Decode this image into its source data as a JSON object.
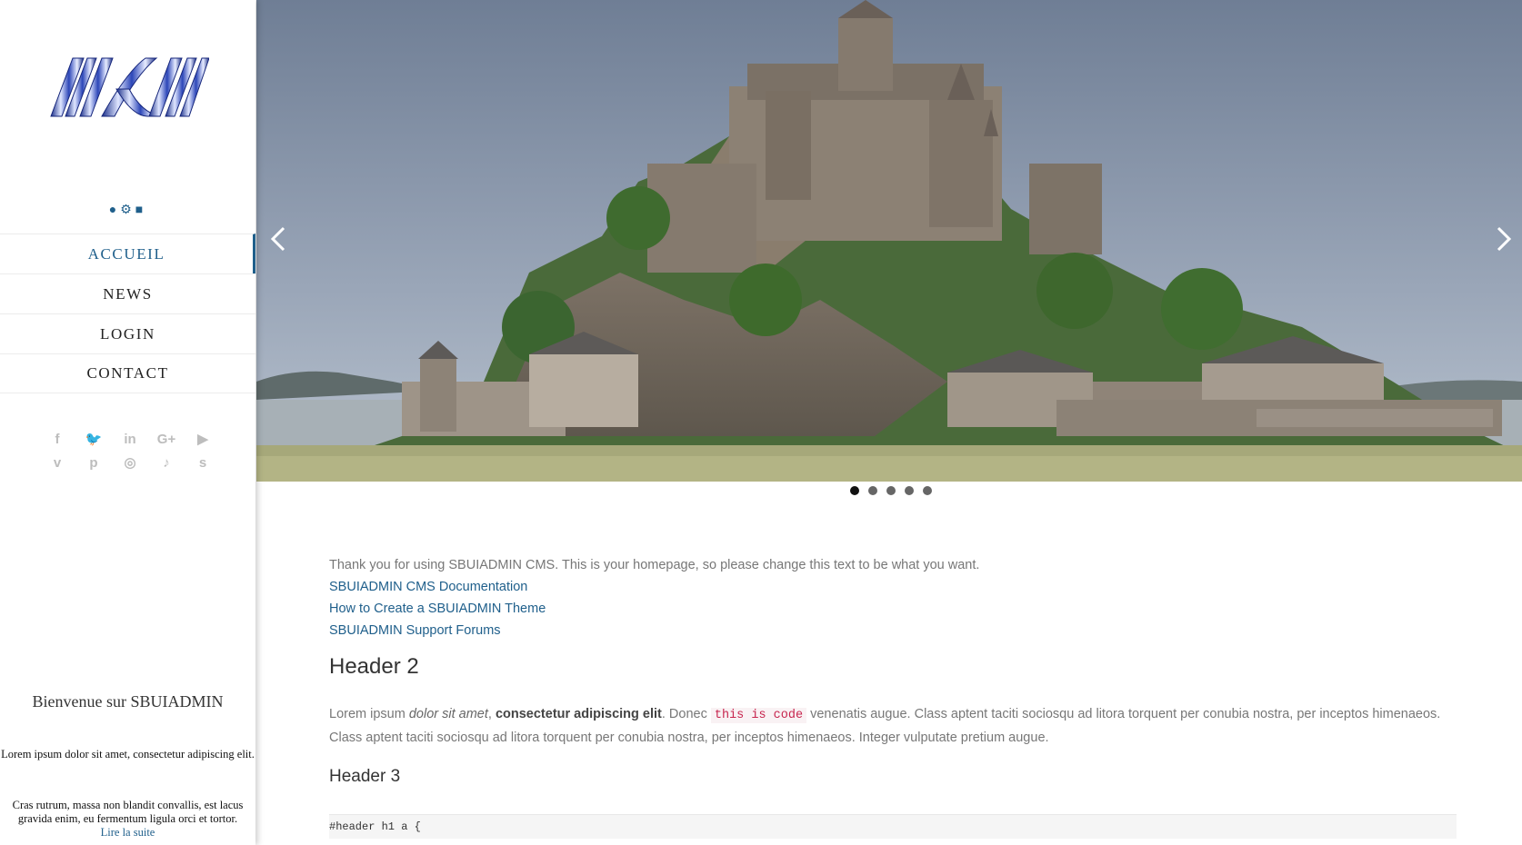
{
  "sidebar": {
    "logo_alt": "SBUIADMIN logo",
    "user_icons": [
      "user-icon",
      "cogs-icon",
      "lock-icon"
    ],
    "nav": [
      {
        "label": "ACCUEIL",
        "active": true
      },
      {
        "label": "NEWS",
        "active": false
      },
      {
        "label": "LOGIN",
        "active": false
      },
      {
        "label": "CONTACT",
        "active": false
      }
    ],
    "social_row1": [
      {
        "icon": "facebook-icon",
        "glyph": "f"
      },
      {
        "icon": "twitter-icon",
        "glyph": "🐦"
      },
      {
        "icon": "linkedin-icon",
        "glyph": "in"
      },
      {
        "icon": "google-plus-icon",
        "glyph": "G+"
      },
      {
        "icon": "youtube-icon",
        "glyph": "▶"
      }
    ],
    "social_row2": [
      {
        "icon": "vimeo-icon",
        "glyph": "v"
      },
      {
        "icon": "pinterest-icon",
        "glyph": "p"
      },
      {
        "icon": "instagram-icon",
        "glyph": "◎"
      },
      {
        "icon": "tiktok-icon",
        "glyph": "♪"
      },
      {
        "icon": "skype-icon",
        "glyph": "s"
      }
    ],
    "welcome": "Bienvenue sur SBUIADMIN",
    "lorem_short": "Lorem ipsum dolor sit amet, consectetur adipiscing elit.",
    "lorem_long": "Cras rutrum, massa non blandit convallis, est lacus gravida enim, eu fermentum ligula orci et tortor.",
    "read_more": "Lire la suite",
    "colors": {
      "accent": "#1f5f8b",
      "social": "#bdbdbd"
    }
  },
  "slider": {
    "slide_count": 5,
    "active_slide": 0,
    "prev_icon": "chevron-left-icon",
    "next_icon": "chevron-right-icon"
  },
  "content": {
    "intro": "Thank you for using SBUIADMIN CMS. This is your homepage, so please change this text to be what you want.",
    "links": [
      "SBUIADMIN CMS Documentation",
      "How to Create a SBUIADMIN Theme",
      "SBUIADMIN Support Forums"
    ],
    "header2": "Header 2",
    "lorem_start": "Lorem ipsum ",
    "lorem_em": "dolor sit amet",
    "lorem_comma": ", ",
    "lorem_bold": "consectetur adipiscing elit",
    "lorem_donec": ". Donec ",
    "lorem_code": "this is code",
    "lorem_rest": " venenatis augue. Class aptent taciti sociosqu ad litora torquent per conubia nostra, per inceptos himenaeos. Class aptent taciti sociosqu ad litora torquent per conubia nostra, per inceptos himenaeos. Integer vulputate pretium augue.",
    "header3": "Header 3",
    "pre_text": "#header h1 a {"
  }
}
